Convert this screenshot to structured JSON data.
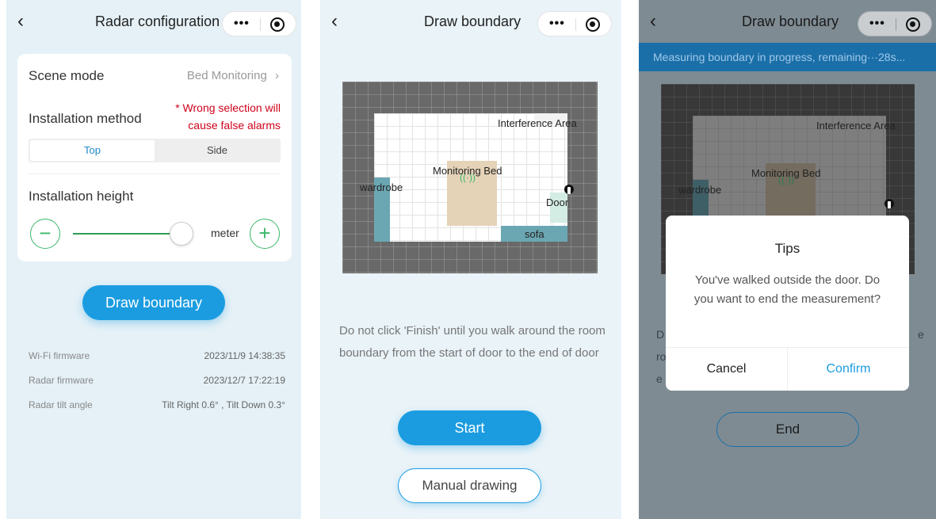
{
  "panel1": {
    "title": "Radar configuration",
    "back_icon": "‹",
    "scene_mode_label": "Scene mode",
    "scene_mode_value": "Bed Monitoring",
    "installation_method_label": "Installation method",
    "warning_line1": "* Wrong selection will",
    "warning_line2": "cause false alarms",
    "method_options": [
      "Top",
      "Side"
    ],
    "selected_method": "Top",
    "installation_height_label": "Installation height",
    "height_unit": "meter",
    "minus_symbol": "−",
    "plus_symbol": "+",
    "draw_boundary_button": "Draw boundary",
    "info": [
      {
        "label": "Wi-Fi firmware",
        "value": "2023/11/9 14:38:35"
      },
      {
        "label": "Radar firmware",
        "value": "2023/12/7 17:22:19"
      },
      {
        "label": "Radar tilt angle",
        "value": "Tilt Right 0.6° , Tilt Down 0.3°"
      }
    ]
  },
  "panel2": {
    "title": "Draw boundary",
    "map_labels": {
      "interference": "Interference Area",
      "bed": "Monitoring Bed",
      "wardrobe": "wardrobe",
      "door": "Door",
      "sofa": "sofa"
    },
    "description": "Do not click 'Finish' until you walk around the room boundary from the start of door to the end of door",
    "start_button": "Start",
    "manual_button": "Manual drawing"
  },
  "panel3": {
    "title": "Draw boundary",
    "banner": "Measuring boundary in progress, remaining···28s...",
    "dialog_title": "Tips",
    "dialog_message": "You've walked outside the door. Do you want to end the measurement?",
    "cancel_button": "Cancel",
    "confirm_button": "Confirm",
    "end_button": "End",
    "peek_letters": [
      "D",
      "ro",
      "e",
      "e"
    ]
  },
  "capsule": {
    "dots": "•••"
  },
  "colors": {
    "primary": "#1b9ce0",
    "green": "#3bb86a",
    "warning": "#d0021b",
    "banner": "#1b6fa9",
    "wardrobe": "#6ba7b3",
    "bed": "#e5d3b8",
    "sofa": "#6ba7b3"
  }
}
